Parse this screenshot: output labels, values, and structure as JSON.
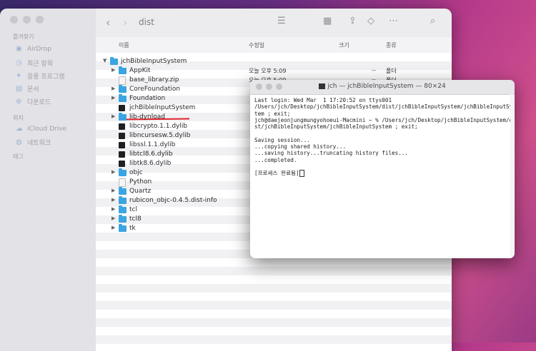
{
  "finder": {
    "sidebar": {
      "favorites_title": "즐겨찾기",
      "favorites": [
        "AirDrop",
        "최근 항목",
        "응용 프로그램",
        "문서",
        "다운로드"
      ],
      "locations_title": "위치",
      "locations": [
        "iCloud Drive",
        "네트워크"
      ],
      "tags_title": "태그"
    },
    "toolbar": {
      "back": "‹",
      "forward": "›",
      "title": "dist"
    },
    "columns": {
      "name": "이름",
      "date": "수정일",
      "size": "크기",
      "kind": "종류"
    },
    "files": [
      {
        "name": "jchBibleInputSystem",
        "type": "folder",
        "expanded": true,
        "level": 0
      },
      {
        "name": "AppKit",
        "type": "folder",
        "level": 1
      },
      {
        "name": "base_library.zip",
        "type": "file",
        "level": 1
      },
      {
        "name": "CoreFoundation",
        "type": "folder",
        "level": 1
      },
      {
        "name": "Foundation",
        "type": "folder",
        "level": 1
      },
      {
        "name": "jchBibleInputSystem",
        "type": "exec",
        "level": 1
      },
      {
        "name": "lib-dynload",
        "type": "folder",
        "level": 1
      },
      {
        "name": "libcrypto.1.1.dylib",
        "type": "exec",
        "level": 1
      },
      {
        "name": "libncursesw.5.dylib",
        "type": "exec",
        "level": 1
      },
      {
        "name": "libssl.1.1.dylib",
        "type": "exec",
        "level": 1
      },
      {
        "name": "libtcl8.6.dylib",
        "type": "exec",
        "level": 1
      },
      {
        "name": "libtk8.6.dylib",
        "type": "exec",
        "level": 1
      },
      {
        "name": "objc",
        "type": "folder",
        "level": 1
      },
      {
        "name": "Python",
        "type": "file",
        "level": 1
      },
      {
        "name": "Quartz",
        "type": "folder",
        "level": 1
      },
      {
        "name": "rubicon_objc-0.4.5.dist-info",
        "type": "folder",
        "level": 1
      },
      {
        "name": "tcl",
        "type": "folder",
        "level": 1
      },
      {
        "name": "tcl8",
        "type": "folder",
        "level": 1
      },
      {
        "name": "tk",
        "type": "folder",
        "level": 1
      }
    ],
    "rows_meta": [
      {
        "date": "오늘 오후 5:09",
        "size": "--",
        "kind": "폴더"
      },
      {
        "date": "오늘 오후 5:09",
        "size": "--",
        "kind": "폴더"
      }
    ]
  },
  "terminal": {
    "title": "jch — jchBibleInputSystem — 80×24",
    "lines": [
      "Last login: Wed Mar  1 17:20:52 on ttys001",
      "/Users/jch/Desktop/jchBibleInputSystem/dist/jchBibleInputSystem/jchBibleInputSys",
      "tem ; exit;",
      "jch@daejeonjungmungyohoeui-Macmini ~ % /Users/jch/Desktop/jchBibleInputSystem/di",
      "st/jchBibleInputSystem/jchBibleInputSystem ; exit;",
      "",
      "Saving session...",
      "...copying shared history...",
      "...saving history...truncating history files...",
      "...completed.",
      "",
      "[프로세스 완료됨]"
    ]
  }
}
